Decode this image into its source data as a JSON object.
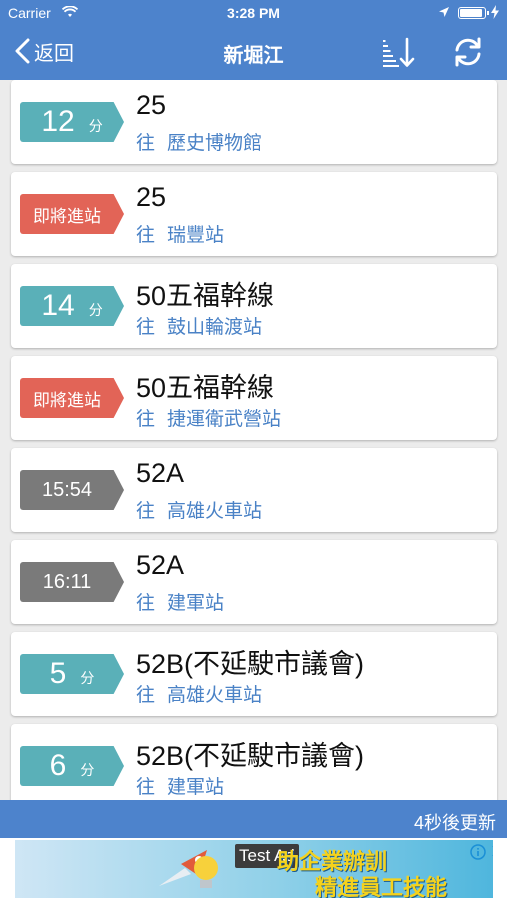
{
  "status_bar": {
    "carrier": "Carrier",
    "time": "3:28 PM"
  },
  "nav": {
    "back_label": "返回",
    "title": "新堀江"
  },
  "colors": {
    "header_blue": "#4d83cc",
    "badge_teal": "#5ab0b8",
    "badge_red": "#e26457",
    "badge_gray": "#7a7a7a",
    "destination_blue": "#4a82c6"
  },
  "arrivals": [
    {
      "badge_kind": "minutes",
      "value": "12",
      "unit": "分",
      "route": "25",
      "to": "往",
      "destination": "歷史博物館"
    },
    {
      "badge_kind": "arriving",
      "value": "即將進站",
      "unit": "",
      "route": "25",
      "to": "往",
      "destination": "瑞豐站"
    },
    {
      "badge_kind": "minutes",
      "value": "14",
      "unit": "分",
      "route": "50五福幹線",
      "to": "往",
      "destination": "鼓山輪渡站"
    },
    {
      "badge_kind": "arriving",
      "value": "即將進站",
      "unit": "",
      "route": "50五福幹線",
      "to": "往",
      "destination": "捷運衛武營站"
    },
    {
      "badge_kind": "time",
      "value": "15:54",
      "unit": "",
      "route": "52A",
      "to": "往",
      "destination": "高雄火車站"
    },
    {
      "badge_kind": "time",
      "value": "16:11",
      "unit": "",
      "route": "52A",
      "to": "往",
      "destination": "建軍站"
    },
    {
      "badge_kind": "minutes",
      "value": "5",
      "unit": "分",
      "route": "52B(不延駛市議會)",
      "to": "往",
      "destination": "高雄火車站"
    },
    {
      "badge_kind": "minutes",
      "value": "6",
      "unit": "分",
      "route": "52B(不延駛市議會)",
      "to": "往",
      "destination": "建軍站"
    }
  ],
  "update_bar": {
    "text": "4秒後更新"
  },
  "ad": {
    "test_label": "Test Ad",
    "slogan_line1": "助企業辦訓",
    "slogan_line2": "精進員工技能"
  }
}
